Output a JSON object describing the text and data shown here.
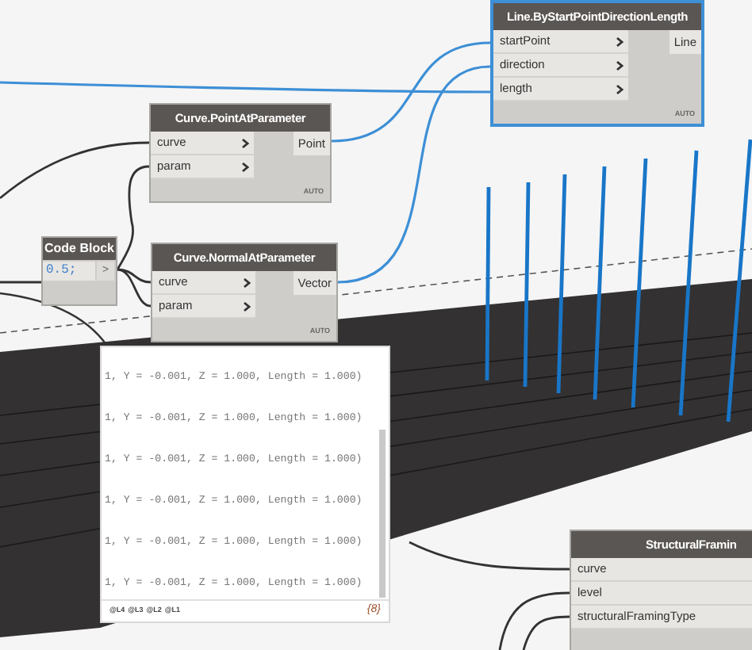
{
  "nodes": [
    {
      "title": "Line.ByStartPointDirectionLength",
      "selected": true,
      "inputs": [
        "startPoint",
        "direction",
        "length"
      ],
      "outputs": [
        "Line"
      ],
      "lacing": "AUTO"
    },
    {
      "title": "Curve.PointAtParameter",
      "selected": false,
      "inputs": [
        "curve",
        "param"
      ],
      "outputs": [
        "Point"
      ],
      "lacing": "AUTO"
    },
    {
      "title": "Curve.NormalAtParameter",
      "selected": false,
      "inputs": [
        "curve",
        "param"
      ],
      "outputs": [
        "Vector"
      ],
      "lacing": "AUTO"
    },
    {
      "title": "StructuralFramin",
      "selected": false,
      "inputs": [
        "curve",
        "level",
        "structuralFramingType"
      ]
    }
  ],
  "code_block": {
    "title": "Code Block",
    "code": "0.5;",
    "output": ">"
  },
  "watch": {
    "rows": [
      "1, Y = -0.001, Z = 1.000, Length = 1.000)",
      "1, Y = -0.001, Z = 1.000, Length = 1.000)",
      "1, Y = -0.001, Z = 1.000, Length = 1.000)",
      "1, Y = -0.001, Z = 1.000, Length = 1.000)",
      "1, Y = -0.001, Z = 1.000, Length = 1.000)",
      "1, Y = -0.001, Z = 1.000, Length = 1.000)"
    ],
    "levels": [
      "@L4",
      "@L3",
      "@L2",
      "@L1"
    ],
    "count": "{8}"
  }
}
